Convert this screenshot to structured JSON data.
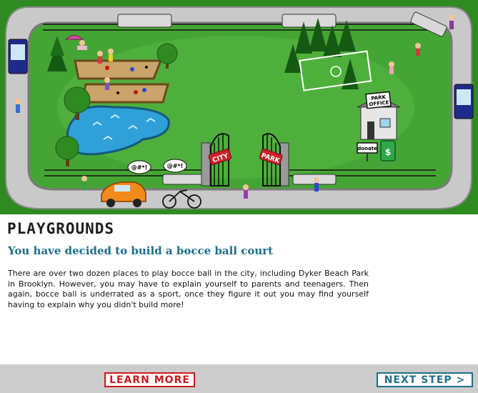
{
  "scene": {
    "gate_left_sign": "CITY",
    "gate_right_sign": "PARK",
    "park_office_sign_line1": "PARK",
    "park_office_sign_line2": "OFFICE",
    "donate_sign": "donate",
    "curse_bubble_1": "@#*!",
    "curse_bubble_2": "@#*!",
    "donation_box_symbol": "$"
  },
  "content": {
    "heading": "PLAYGROUNDS",
    "subheading": "You have decided to build a bocce ball court",
    "body": "There are over two dozen places to play bocce ball in the city, including Dyker Beach Park in Brooklyn. However, you may have to explain yourself to parents and teenagers. Then again, bocce ball is underrated as a sport, once they figure it out you may find yourself having to explain why you didn't build more!"
  },
  "footer": {
    "learn_more_label": "LEARN MORE",
    "next_step_label": "NEXT STEP >"
  },
  "colors": {
    "grass": "#3f9c2c",
    "road": "#c8c8c8",
    "learn_more": "#cc1a1a",
    "next_step": "#1c6f8a",
    "subheading": "#1c6f8a"
  }
}
